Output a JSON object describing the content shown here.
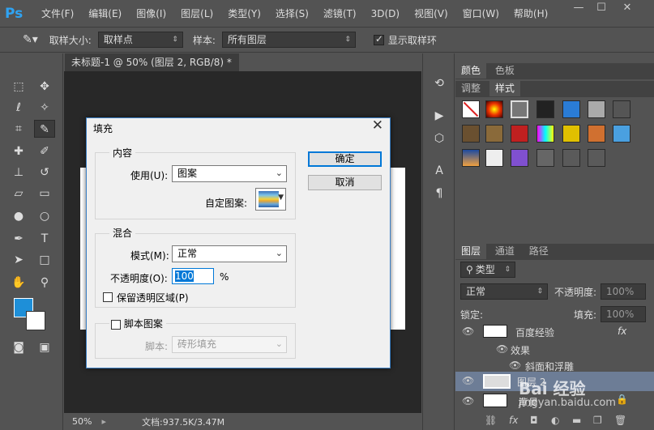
{
  "app": {
    "logo": "Ps"
  },
  "menu": [
    "文件(F)",
    "编辑(E)",
    "图像(I)",
    "图层(L)",
    "类型(Y)",
    "选择(S)",
    "滤镜(T)",
    "3D(D)",
    "视图(V)",
    "窗口(W)",
    "帮助(H)"
  ],
  "window_controls": {
    "minimize": "—",
    "restore": "☐",
    "close": "✕"
  },
  "options": {
    "sample_size_label": "取样大小:",
    "sample_size_value": "取样点",
    "sample_label": "样本:",
    "sample_value": "所有图层",
    "show_ring_label": "显示取样环",
    "show_ring_checked": true
  },
  "document": {
    "tab_title": "未标题-1 @ 50% (图层 2, RGB/8) *",
    "tab_close": "×",
    "zoom": "50%",
    "doc_size": "文档:937.5K/3.47M"
  },
  "right_panel": {
    "top_tabs": [
      "颜色",
      "色板"
    ],
    "style_tabs": [
      "调整",
      "样式"
    ],
    "layers_tabs": [
      "图层",
      "通道",
      "路径"
    ],
    "kind_filter": "类型",
    "blend_mode": "正常",
    "opacity_label": "不透明度:",
    "opacity_value": "100%",
    "lock_label": "锁定:",
    "fill_label": "填充:",
    "fill_value": "100%",
    "layers": [
      {
        "name": "百度经验",
        "fx": "fx"
      },
      {
        "name": "效果"
      },
      {
        "name": "斜面和浮雕"
      },
      {
        "name": "图层 2"
      },
      {
        "name": "背景"
      }
    ]
  },
  "dialog": {
    "title": "填充",
    "close": "✕",
    "content_group": "内容",
    "use_label": "使用(U):",
    "use_value": "图案",
    "custom_pattern_label": "自定图案:",
    "blend_group": "混合",
    "mode_label": "模式(M):",
    "mode_value": "正常",
    "opacity_label": "不透明度(O):",
    "opacity_value": "100",
    "opacity_unit": "%",
    "preserve_label": "保留透明区域(P)",
    "script_group_label": "脚本图案",
    "script_label": "脚本:",
    "script_value": "砖形填充",
    "ok": "确定",
    "cancel": "取消"
  },
  "watermark": {
    "main": "Bai 经验",
    "sub": "jingyan.baidu.com"
  },
  "colors": {
    "foreground": "#1e8fd8",
    "background": "#ffffff",
    "accent": "#0078d7"
  }
}
